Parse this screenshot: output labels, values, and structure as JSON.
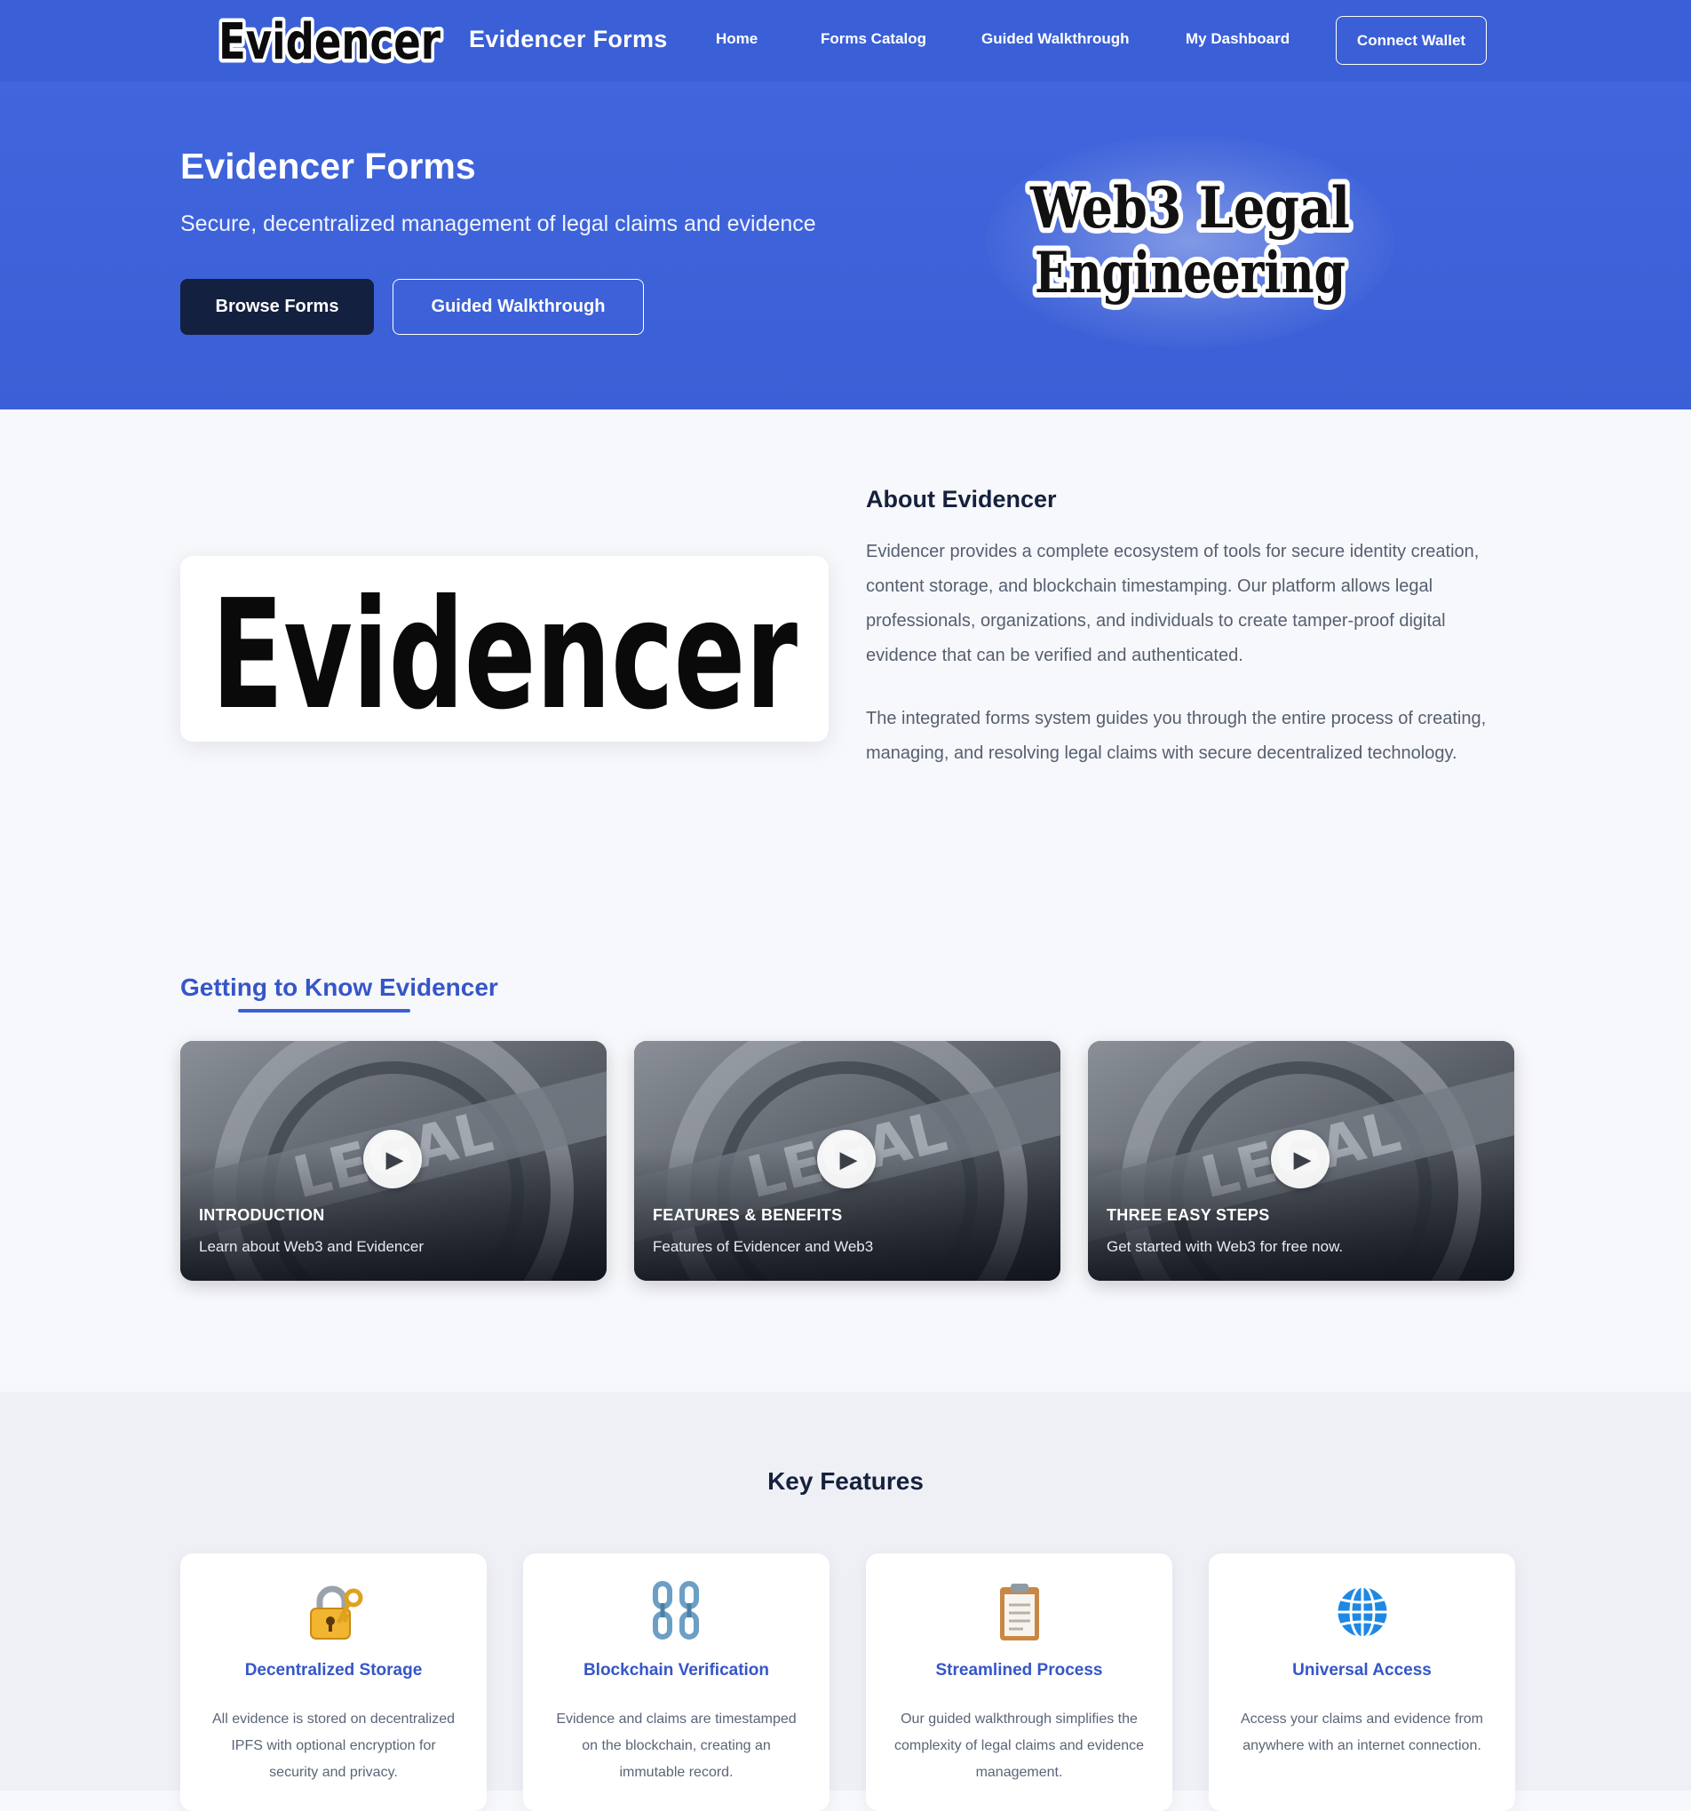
{
  "nav": {
    "logo_text": "Evidencer",
    "brand": "Evidencer Forms",
    "links": [
      "Home",
      "Forms Catalog",
      "Guided Walkthrough",
      "My Dashboard"
    ],
    "connect_wallet": "Connect Wallet"
  },
  "hero": {
    "title": "Evidencer Forms",
    "subtitle": "Secure, decentralized management of legal claims and evidence",
    "primary_button": "Browse Forms",
    "secondary_button": "Guided Walkthrough",
    "art_line1": "Web3 Legal",
    "art_line2": "Engineering"
  },
  "about": {
    "logo_text": "Evidencer",
    "title": "About Evidencer",
    "paragraphs": [
      "Evidencer provides a complete ecosystem of tools for secure identity creation, content storage, and blockchain timestamping. Our platform allows legal professionals, organizations, and individuals to create tamper-proof digital evidence that can be verified and authenticated.",
      "The integrated forms system guides you through the entire process of creating, managing, and resolving legal claims with secure decentralized technology."
    ]
  },
  "getting_to_know": {
    "title": "Getting to Know Evidencer",
    "videos": [
      {
        "title": "INTRODUCTION",
        "description": "Learn about Web3 and Evidencer"
      },
      {
        "title": "FEATURES & BENEFITS",
        "description": "Features of Evidencer and Web3"
      },
      {
        "title": "THREE EASY STEPS",
        "description": "Get started with Web3 for free now."
      }
    ]
  },
  "key_features": {
    "title": "Key Features",
    "items": [
      {
        "icon": "lock-with-key-icon",
        "glyph": "🔐",
        "name": "Decentralized Storage",
        "description": "All evidence is stored on decentralized IPFS with optional encryption for security and privacy."
      },
      {
        "icon": "chain-icon",
        "glyph": "⛓",
        "name": "Blockchain Verification",
        "description": "Evidence and claims are timestamped on the blockchain, creating an immutable record."
      },
      {
        "icon": "clipboard-icon",
        "glyph": "📋",
        "name": "Streamlined Process",
        "description": "Our guided walkthrough simplifies the complexity of legal claims and evidence management."
      },
      {
        "icon": "globe-icon",
        "glyph": "🌐",
        "name": "Universal Access",
        "description": "Access your claims and evidence from anywhere with an internet connection."
      }
    ]
  },
  "colors": {
    "primary_blue": "#3a5fd6",
    "dark_navy": "#13203f",
    "accent_text_blue": "#3556c8"
  }
}
